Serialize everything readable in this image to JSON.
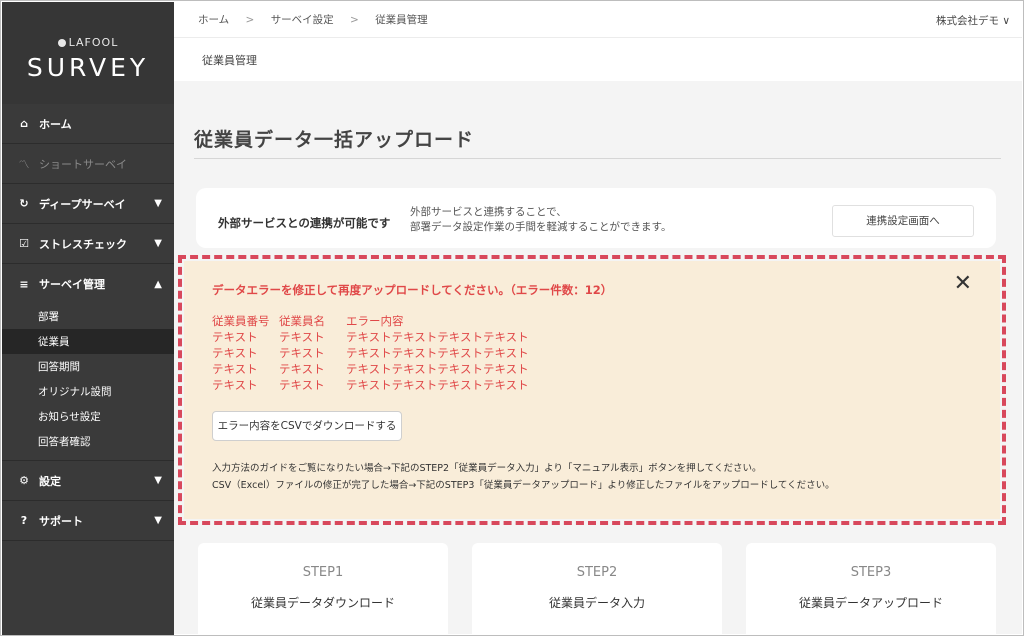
{
  "sidebar": {
    "brand_small": "LAFOOL",
    "brand_name": "SURVEY",
    "items": [
      {
        "label": "ホーム",
        "icon": "home-icon"
      },
      {
        "label": "ショートサーベイ",
        "icon": "chart-line-icon"
      },
      {
        "label": "ディープサーベイ",
        "icon": "circle-arrow-icon"
      },
      {
        "label": "ストレスチェック",
        "icon": "checkbox-icon"
      },
      {
        "label": "サーベイ管理",
        "icon": "sliders-icon"
      },
      {
        "label": "設定",
        "icon": "gear-icon"
      },
      {
        "label": "サポート",
        "icon": "question-icon"
      }
    ],
    "sub_items": [
      "部署",
      "従業員",
      "回答期間",
      "オリジナル設問",
      "お知らせ設定",
      "回答者確認"
    ]
  },
  "topbar": {
    "breadcrumb": [
      "ホーム",
      "サーベイ設定",
      "従業員管理"
    ],
    "company": "株式会社デモ"
  },
  "subbar": {
    "label": "従業員管理"
  },
  "main": {
    "title": "従業員データ一括アップロード",
    "link_card": {
      "title": "外部サービスとの連携が可能です",
      "desc_line1": "外部サービスと連携することで、",
      "desc_line2": "部署データ設定作業の手間を軽減することができます。",
      "button": "連携設定画面へ"
    },
    "error": {
      "heading": "データエラーを修正して再度アップロードしてください。（エラー件数：12）",
      "headers": [
        "従業員番号",
        "従業員名",
        "エラー内容"
      ],
      "rows": [
        [
          "テキスト",
          "テキスト",
          "テキストテキストテキストテキスト"
        ],
        [
          "テキスト",
          "テキスト",
          "テキストテキストテキストテキスト"
        ],
        [
          "テキスト",
          "テキスト",
          "テキストテキストテキストテキスト"
        ],
        [
          "テキスト",
          "テキスト",
          "テキストテキストテキストテキスト"
        ]
      ],
      "download_button": "エラー内容をCSVでダウンロードする",
      "note1": "入力方法のガイドをご覧になりたい場合→下記のSTEP2「従業員データ入力」より「マニュアル表示」ボタンを押してください。",
      "note2": "CSV（Excel）ファイルの修正が完了した場合→下記のSTEP3「従業員データアップロード」より修正したファイルをアップロードしてください。",
      "error_color": "#e04848"
    },
    "steps": [
      {
        "num": "STEP1",
        "label": "従業員データダウンロード"
      },
      {
        "num": "STEP2",
        "label": "従業員データ入力"
      },
      {
        "num": "STEP3",
        "label": "従業員データアップロード"
      }
    ]
  }
}
